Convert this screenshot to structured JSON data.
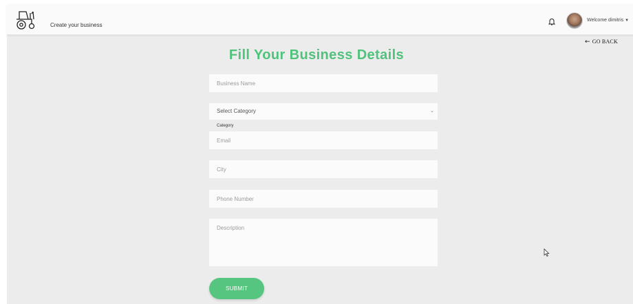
{
  "header": {
    "page_label": "Create your business",
    "welcome": "Welcome dimitris",
    "icons": {
      "logo": "tractor-icon",
      "bell": "bell-icon",
      "caret": "caret-down-icon"
    }
  },
  "nav": {
    "go_back": "GO BACK",
    "go_back_icon": "arrow-left-icon"
  },
  "form": {
    "title": "Fill Your Business Details",
    "business_name": {
      "placeholder": "Business Name",
      "value": ""
    },
    "category": {
      "selected": "Select Category",
      "label": "Category"
    },
    "email": {
      "placeholder": "Email",
      "value": ""
    },
    "city": {
      "placeholder": "City",
      "value": ""
    },
    "phone": {
      "placeholder": "Phone Number",
      "value": ""
    },
    "description": {
      "placeholder": "Description",
      "value": ""
    },
    "submit_label": "SUBMIT"
  },
  "colors": {
    "accent": "#4fc27c",
    "button": "#55c57f",
    "background": "#ececec",
    "topbar": "#fafafa"
  }
}
